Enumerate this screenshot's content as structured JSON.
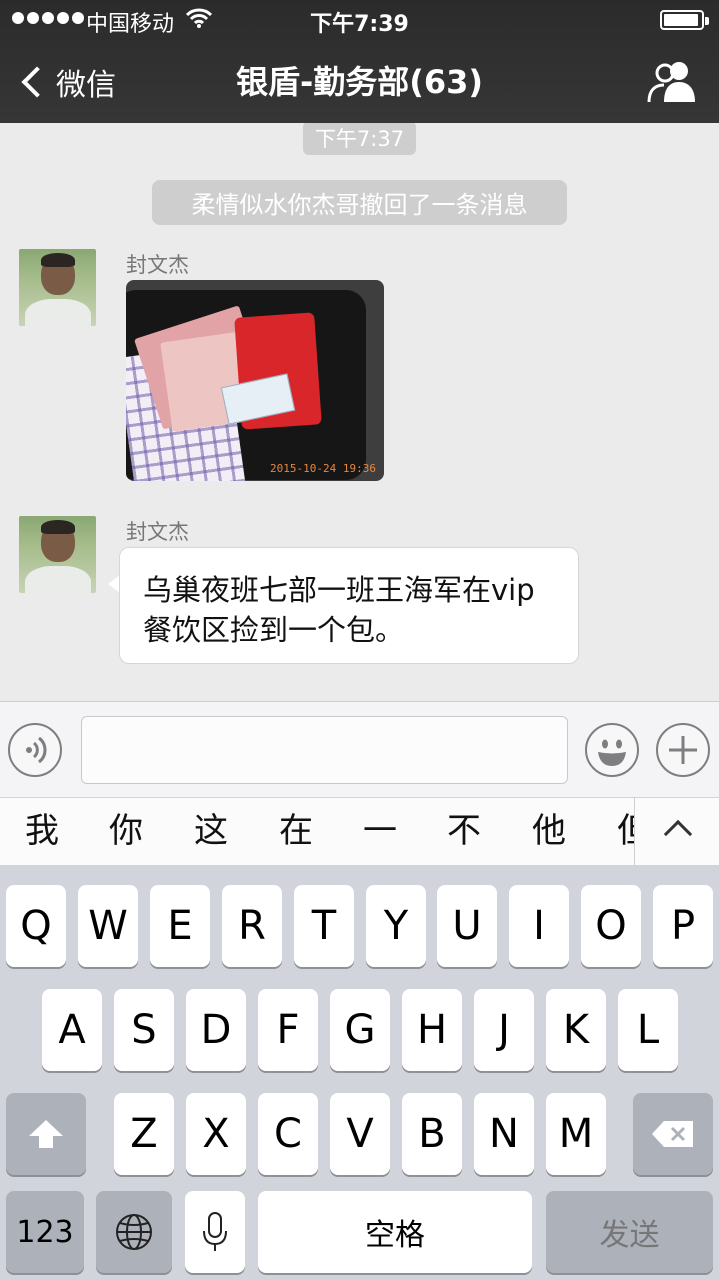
{
  "status_bar": {
    "carrier": "中国移动",
    "time": "下午7:39"
  },
  "nav": {
    "back_label": "微信",
    "title": "银盾-勤务部(63)"
  },
  "chat": {
    "timestamp": "下午7:37",
    "system_notice": "柔情似水你杰哥撤回了一条消息",
    "messages": [
      {
        "sender": "封文杰",
        "type": "image",
        "image_timestamp": "2015-10-24 19:36"
      },
      {
        "sender": "封文杰",
        "type": "text",
        "lines": [
          "乌巢夜班七部一班王海军在vip",
          "餐饮区捡到一个包。"
        ]
      }
    ]
  },
  "candidates": [
    "我",
    "你",
    "这",
    "在",
    "一",
    "不",
    "他",
    "但"
  ],
  "keyboard": {
    "row1": [
      "Q",
      "W",
      "E",
      "R",
      "T",
      "Y",
      "U",
      "I",
      "O",
      "P"
    ],
    "row2": [
      "A",
      "S",
      "D",
      "F",
      "G",
      "H",
      "J",
      "K",
      "L"
    ],
    "row3": [
      "Z",
      "X",
      "C",
      "V",
      "B",
      "N",
      "M"
    ],
    "numbers_label": "123",
    "space_label": "空格",
    "send_label": "发送"
  },
  "icons": {
    "back": "chevron-left-icon",
    "contacts": "group-contacts-icon",
    "voice": "voice-input-icon",
    "emoji": "emoji-icon",
    "plus": "plus-icon",
    "shift": "shift-icon",
    "backspace": "backspace-icon",
    "globe": "globe-icon",
    "mic": "microphone-icon"
  }
}
